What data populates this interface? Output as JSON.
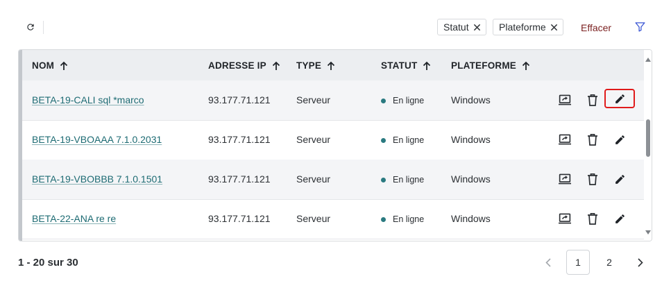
{
  "toolbar": {
    "refresh_icon": "refresh-icon",
    "chips": [
      {
        "label": "Statut"
      },
      {
        "label": "Plateforme"
      }
    ],
    "clear_label": "Effacer",
    "filter_icon": "filter-icon"
  },
  "table": {
    "columns": [
      {
        "label": "NOM"
      },
      {
        "label": "ADRESSE IP"
      },
      {
        "label": "TYPE"
      },
      {
        "label": "STATUT"
      },
      {
        "label": "PLATEFORME"
      }
    ],
    "rows": [
      {
        "name": "BETA-19-CALI sql *marco",
        "ip": "93.177.71.121",
        "type": "Serveur",
        "status": "En ligne",
        "platform": "Windows"
      },
      {
        "name": "BETA-19-VBOAAA 7.1.0.2031",
        "ip": "93.177.71.121",
        "type": "Serveur",
        "status": "En ligne",
        "platform": "Windows"
      },
      {
        "name": "BETA-19-VBOBBB 7.1.0.1501",
        "ip": "93.177.71.121",
        "type": "Serveur",
        "status": "En ligne",
        "platform": "Windows"
      },
      {
        "name": "BETA-22-ANA re re",
        "ip": "93.177.71.121",
        "type": "Serveur",
        "status": "En ligne",
        "platform": "Windows"
      }
    ],
    "status_color": "#2a7a80",
    "highlight_color": "#e01b1b"
  },
  "footer": {
    "count_text": "1 - 20 sur 30",
    "pages": [
      "1",
      "2"
    ],
    "current_page": "1"
  }
}
